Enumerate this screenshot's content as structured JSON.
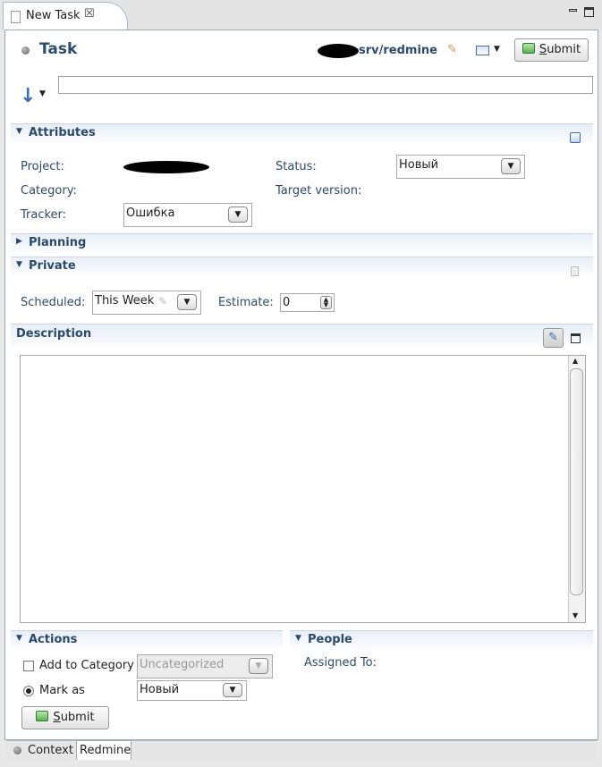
{
  "tab": {
    "title": "New Task",
    "close": "☒"
  },
  "header": {
    "title": "Task",
    "repository": "srv/redmine",
    "submit_label": "Submit",
    "submit_accel": "S",
    "submit_rest": "ubmit"
  },
  "summary": {
    "value": "",
    "priority_icon": "↓"
  },
  "attributes": {
    "section_title": "Attributes",
    "project_label": "Project:",
    "status_label": "Status:",
    "status_value": "Новый",
    "category_label": "Category:",
    "target_version_label": "Target version:",
    "tracker_label": "Tracker:",
    "tracker_value": "Ошибка"
  },
  "planning": {
    "section_title": "Planning"
  },
  "private": {
    "section_title": "Private",
    "scheduled_label": "Scheduled:",
    "scheduled_value": "This Week",
    "estimate_label": "Estimate:",
    "estimate_value": "0"
  },
  "description": {
    "section_title": "Description",
    "value": ""
  },
  "actions": {
    "section_title": "Actions",
    "add_to_category_label": "Add to Category",
    "category_placeholder": "Uncategorized",
    "mark_as_label": "Mark as",
    "mark_as_value": "Новый",
    "submit_accel": "S",
    "submit_rest": "ubmit"
  },
  "people": {
    "section_title": "People",
    "assigned_to_label": "Assigned To:"
  },
  "bottom_tabs": {
    "context": "Context",
    "redmine": "Redmine"
  },
  "colors": {
    "section_text": "#2c4a6e",
    "frame": "#9aa7b8",
    "accent": "#5db150"
  }
}
